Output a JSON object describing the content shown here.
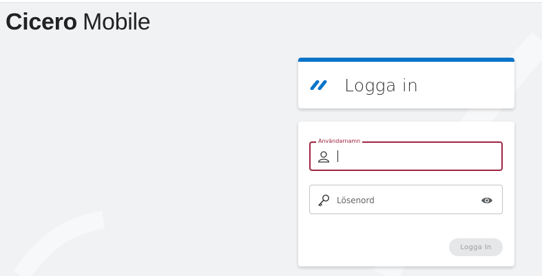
{
  "app": {
    "brand": "Cicero",
    "suffix": "Mobile"
  },
  "header_card": {
    "title": "Logga in",
    "logo_icon": "cicero-logo-icon",
    "accent_color": "#0a74c9"
  },
  "form": {
    "username": {
      "label": "Användarnamn",
      "value": "",
      "icon": "user-icon",
      "focus_color": "#a0223f"
    },
    "password": {
      "placeholder": "Lösenord",
      "value": "",
      "icon": "key-icon",
      "toggle_icon": "eye-icon"
    },
    "submit_label": "Logga In"
  }
}
